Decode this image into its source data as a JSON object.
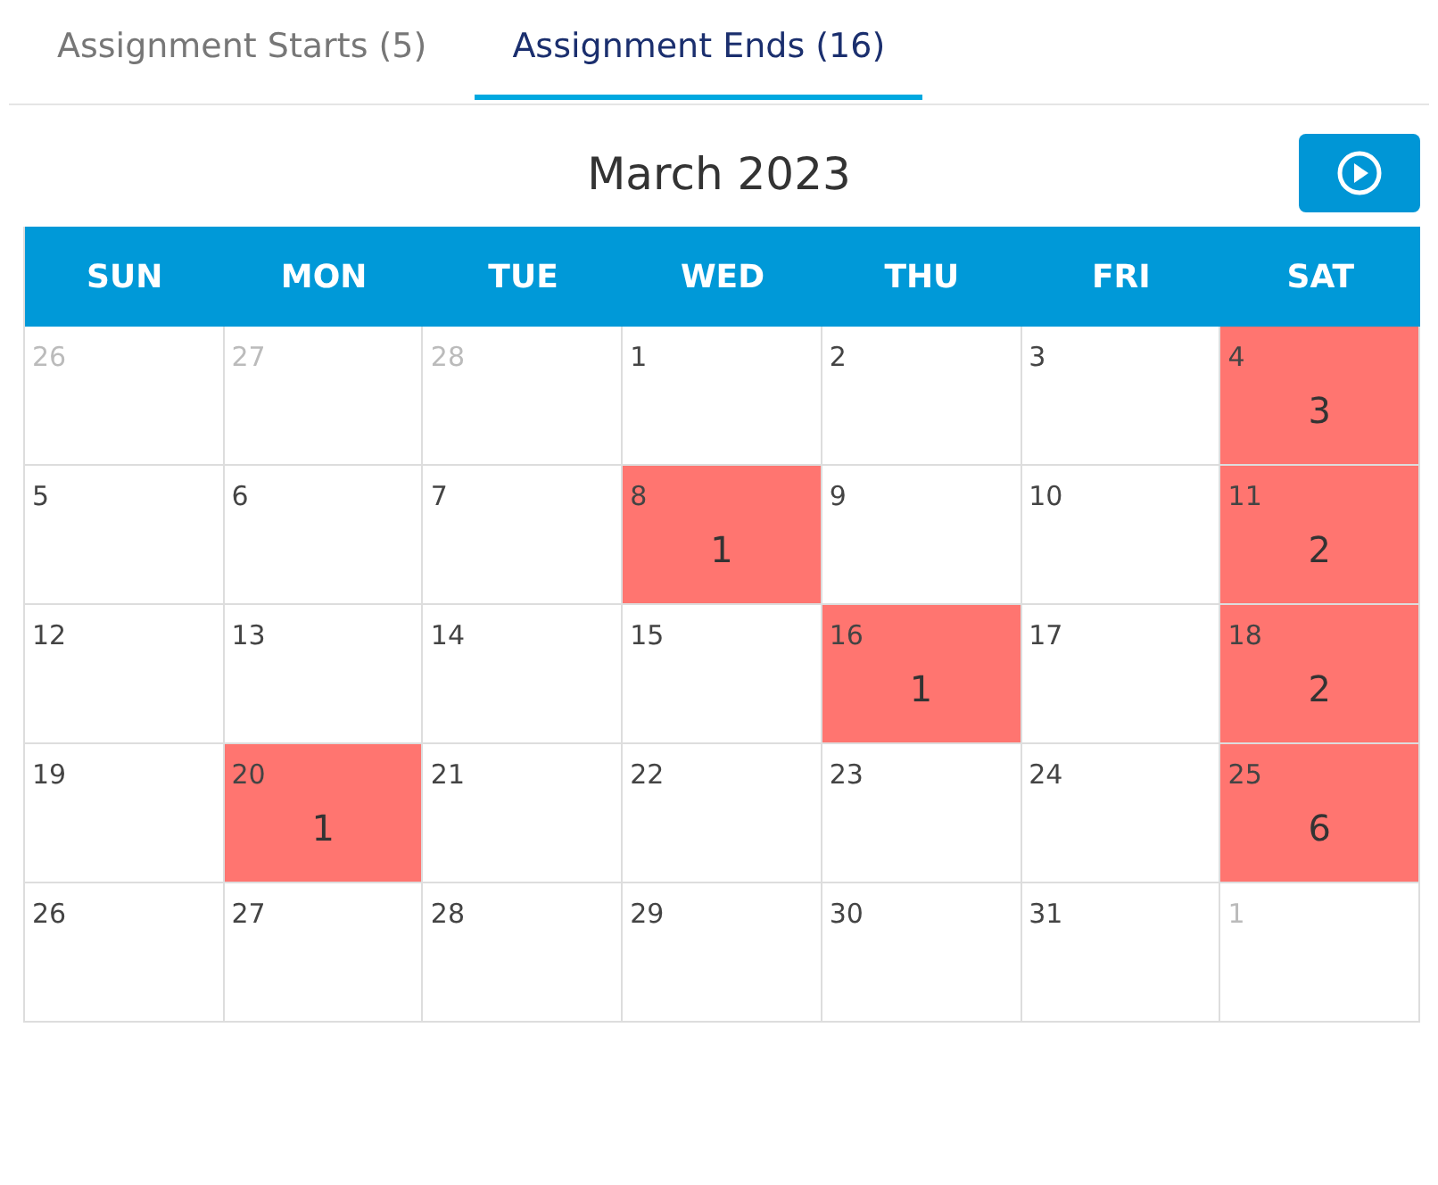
{
  "tabs": [
    {
      "label": "Assignment Starts (5)",
      "selected": false
    },
    {
      "label": "Assignment Ends (16)",
      "selected": true
    }
  ],
  "calendar": {
    "title": "March 2023",
    "weekdays": [
      "SUN",
      "MON",
      "TUE",
      "WED",
      "THU",
      "FRI",
      "SAT"
    ],
    "weeks": [
      [
        {
          "day": "26",
          "outside": true
        },
        {
          "day": "27",
          "outside": true
        },
        {
          "day": "28",
          "outside": true
        },
        {
          "day": "1",
          "outside": false
        },
        {
          "day": "2",
          "outside": false
        },
        {
          "day": "3",
          "outside": false
        },
        {
          "day": "4",
          "outside": false,
          "count": "3"
        }
      ],
      [
        {
          "day": "5",
          "outside": false
        },
        {
          "day": "6",
          "outside": false
        },
        {
          "day": "7",
          "outside": false
        },
        {
          "day": "8",
          "outside": false,
          "count": "1"
        },
        {
          "day": "9",
          "outside": false
        },
        {
          "day": "10",
          "outside": false
        },
        {
          "day": "11",
          "outside": false,
          "count": "2"
        }
      ],
      [
        {
          "day": "12",
          "outside": false
        },
        {
          "day": "13",
          "outside": false
        },
        {
          "day": "14",
          "outside": false
        },
        {
          "day": "15",
          "outside": false
        },
        {
          "day": "16",
          "outside": false,
          "count": "1"
        },
        {
          "day": "17",
          "outside": false
        },
        {
          "day": "18",
          "outside": false,
          "count": "2"
        }
      ],
      [
        {
          "day": "19",
          "outside": false
        },
        {
          "day": "20",
          "outside": false,
          "count": "1"
        },
        {
          "day": "21",
          "outside": false
        },
        {
          "day": "22",
          "outside": false
        },
        {
          "day": "23",
          "outside": false
        },
        {
          "day": "24",
          "outside": false
        },
        {
          "day": "25",
          "outside": false,
          "count": "6"
        }
      ],
      [
        {
          "day": "26",
          "outside": false
        },
        {
          "day": "27",
          "outside": false
        },
        {
          "day": "28",
          "outside": false
        },
        {
          "day": "29",
          "outside": false
        },
        {
          "day": "30",
          "outside": false
        },
        {
          "day": "31",
          "outside": false
        },
        {
          "day": "1",
          "outside": true
        }
      ]
    ]
  }
}
